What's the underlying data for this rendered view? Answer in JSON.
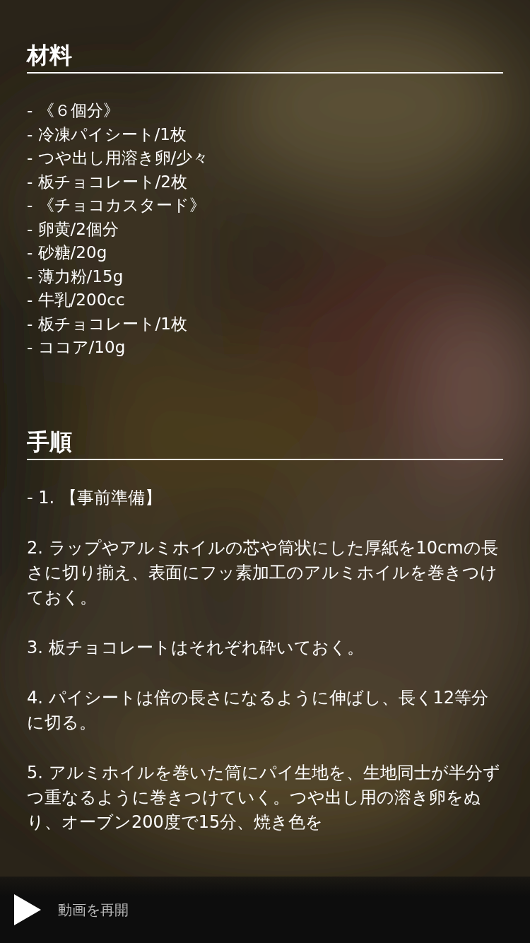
{
  "sections": [
    {
      "title": "材料",
      "kind": "list",
      "items": [
        "- 《６個分》",
        "- 冷凍パイシート/1枚",
        "- つや出し用溶き卵/少々",
        "- 板チョコレート/2枚",
        "- 《チョコカスタード》",
        "- 卵黄/2個分",
        "- 砂糖/20g",
        "- 薄力粉/15g",
        "- 牛乳/200cc",
        "- 板チョコレート/1枚",
        "- ココア/10g"
      ]
    },
    {
      "title": "手順",
      "kind": "steps",
      "items": [
        "- 1. 【事前準備】",
        "2. ラップやアルミホイルの芯や筒状にした厚紙を10cmの長さに切り揃え、表面にフッ素加工のアルミホイルを巻きつけておく。",
        "3. 板チョコレートはそれぞれ砕いておく。",
        "4. パイシートは倍の長さになるように伸ばし、長く12等分に切る。",
        "5. アルミホイルを巻いた筒にパイ生地を、生地同士が半分ずつ重なるように巻きつけていく。つや出し用の溶き卵をぬり、オーブン200度で15分、焼き色を"
      ]
    }
  ],
  "player": {
    "label": "動画を再開"
  }
}
